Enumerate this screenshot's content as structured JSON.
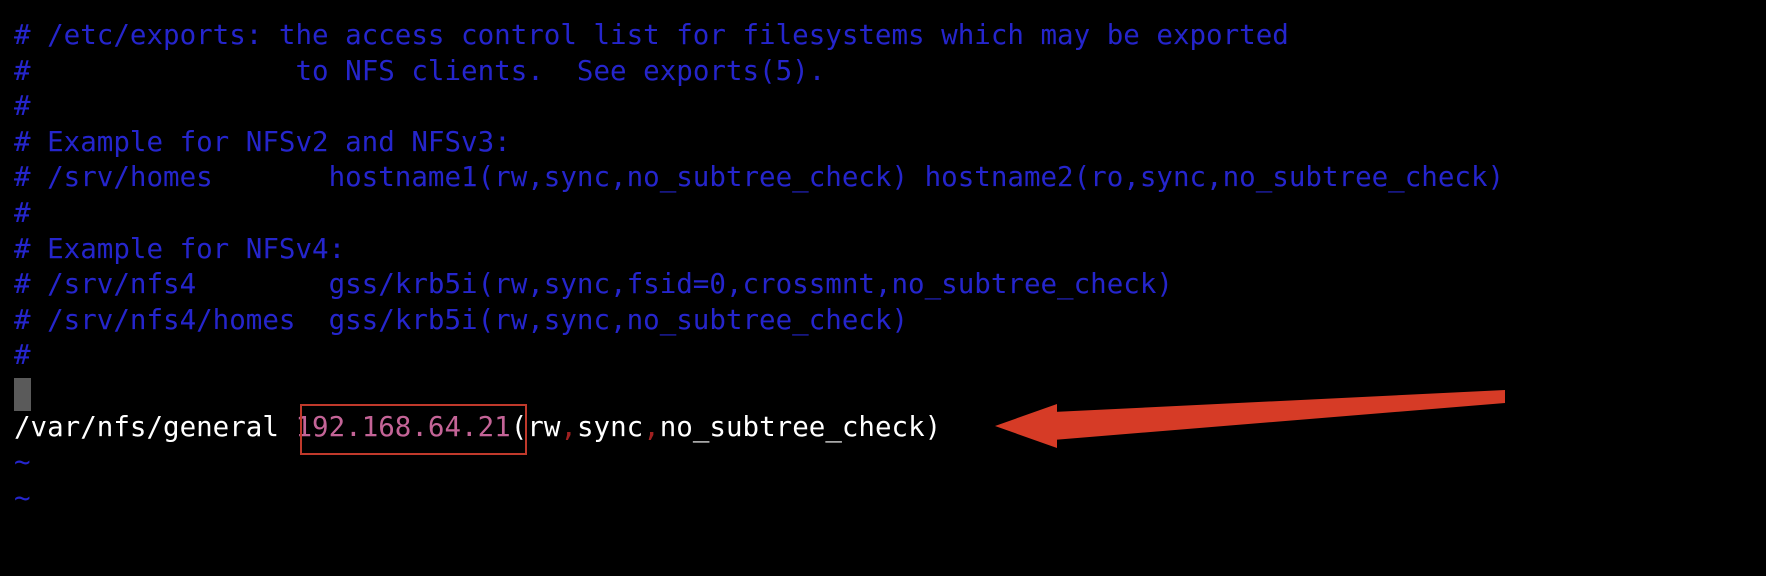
{
  "app": {
    "type": "terminal-text-editor",
    "background_color": "#000000"
  },
  "colors": {
    "comment": "#2525cc",
    "text": "#ffffff",
    "ip_address": "#c46497",
    "punctuation": "#a02020",
    "annotation": "#c0392b",
    "arrow": "#d63b26",
    "cursor": "#5a5a5a"
  },
  "file": {
    "lines": [
      {
        "id": 1,
        "kind": "comment",
        "text": "# /etc/exports: the access control list for filesystems which may be exported"
      },
      {
        "id": 2,
        "kind": "comment",
        "text": "#\t\t to NFS clients.  See exports(5)."
      },
      {
        "id": 3,
        "kind": "comment",
        "text": "#"
      },
      {
        "id": 4,
        "kind": "comment",
        "text": "# Example for NFSv2 and NFSv3:"
      },
      {
        "id": 5,
        "kind": "comment",
        "text": "# /srv/homes       hostname1(rw,sync,no_subtree_check) hostname2(ro,sync,no_subtree_check)"
      },
      {
        "id": 6,
        "kind": "comment",
        "text": "#"
      },
      {
        "id": 7,
        "kind": "comment",
        "text": "# Example for NFSv4:"
      },
      {
        "id": 8,
        "kind": "comment",
        "text": "# /srv/nfs4        gss/krb5i(rw,sync,fsid=0,crossmnt,no_subtree_check)"
      },
      {
        "id": 9,
        "kind": "comment",
        "text": "# /srv/nfs4/homes  gss/krb5i(rw,sync,no_subtree_check)"
      },
      {
        "id": 10,
        "kind": "comment",
        "text": "#"
      },
      {
        "id": 11,
        "kind": "blank-cursor",
        "text": ""
      },
      {
        "id": 12,
        "kind": "export",
        "text": "/var/nfs/general 192.168.64.21(rw,sync,no_subtree_check)"
      },
      {
        "id": 13,
        "kind": "tilde",
        "text": "~"
      },
      {
        "id": 14,
        "kind": "tilde",
        "text": "~"
      }
    ]
  },
  "export_line": {
    "path": "/var/nfs/general ",
    "ip": "192.168.64.21",
    "open_paren": "(",
    "opt_rw": "rw",
    "comma1": ",",
    "opt_sync": "sync",
    "comma2": ",",
    "opt_no_subtree": "no_subtree_check",
    "close_paren": ")"
  },
  "annotations": {
    "highlight_box": {
      "target": "192.168.64.21",
      "shape": "rectangle",
      "color": "#c0392b"
    },
    "arrow": {
      "direction": "left",
      "points_to": "/var/nfs/general 192.168.64.21(rw,sync,no_subtree_check)",
      "color": "#d63b26"
    }
  }
}
